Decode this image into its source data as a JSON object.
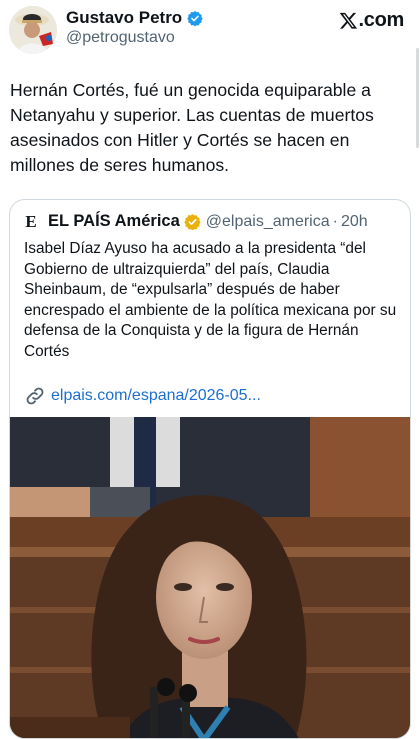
{
  "header": {
    "author_name": "Gustavo Petro",
    "author_handle": "@petrogustavo",
    "site_label": ".com"
  },
  "tweet": {
    "text": "Hernán Cortés,  fué un genocida equiparable a Netanyahu y superior. Las cuentas de muertos asesinados con Hitler y Cortés se hacen en millones de seres humanos."
  },
  "quoted": {
    "source_mark": "E",
    "name": "EL PAÍS América",
    "handle": "@elpais_america",
    "separator": "·",
    "time": "20h",
    "text": "Isabel Díaz Ayuso ha acusado a la presidenta “del Gobierno de ultraizquierda” del país, Claudia Sheinbaum, de “expulsarla” después de haber encrespado el ambiente de la política mexicana por su defensa de la Conquista y de la figura de Hernán Cortés",
    "link_text": "elpais.com/espana/2026-05..."
  },
  "icons": {
    "verified": "verified-badge-icon",
    "gold_verified": "gold-verified-badge-icon",
    "link": "link-icon",
    "x_logo": "x-logo-icon"
  },
  "colors": {
    "verified_blue": "#1d9bf0",
    "gold": "#e8b10c",
    "link": "#1d6fcf",
    "secondary_text": "#536471"
  }
}
